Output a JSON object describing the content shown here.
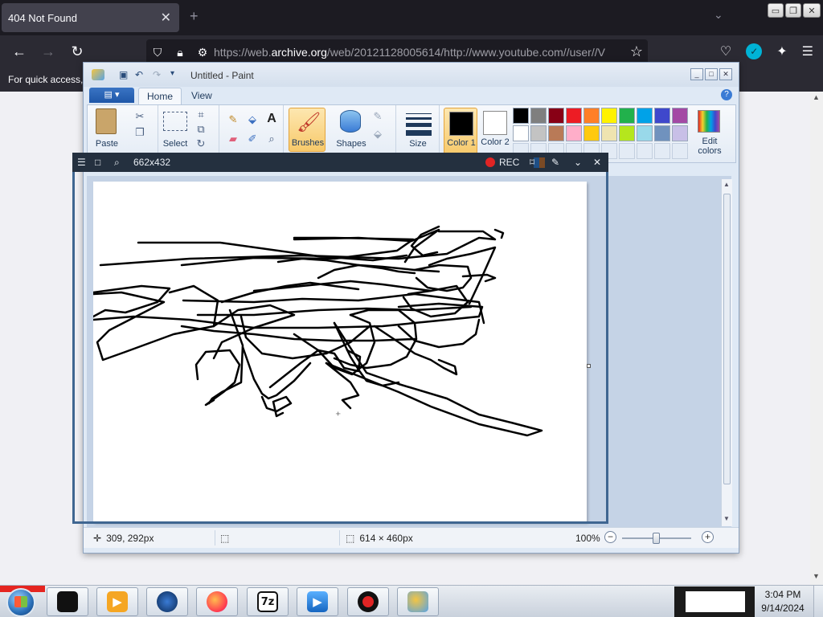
{
  "browser": {
    "tab_title": "404 Not Found",
    "tab_close": "✕",
    "new_tab": "+",
    "url_prefix": "https://web.",
    "url_domain": "archive.org",
    "url_rest": "/web/20121128005614/http://www.youtube.com//user//V",
    "bookmarks_text": "For quick access,",
    "window_controls": [
      "▭",
      "❐",
      "✕"
    ]
  },
  "paint": {
    "title": "Untitled - Paint",
    "tabs": [
      "Home",
      "View"
    ],
    "active_tab": "Home",
    "groups": {
      "paste": "Paste",
      "select": "Select",
      "brushes": "Brushes",
      "shapes": "Shapes",
      "size": "Size",
      "color1": "Color 1",
      "color2": "Color 2",
      "edit_colors": "Edit colors"
    },
    "color1": "#000000",
    "color2": "#ffffff",
    "palette_row1": [
      "#000000",
      "#7f7f7f",
      "#880015",
      "#ed1c24",
      "#ff7f27",
      "#fff200",
      "#22b14c",
      "#00a2e8",
      "#3f48cc",
      "#a349a4"
    ],
    "palette_row2": [
      "#ffffff",
      "#c3c3c3",
      "#b97a57",
      "#ffaec9",
      "#ffc90e",
      "#efe4b0",
      "#b5e61d",
      "#99d9ea",
      "#7092be",
      "#c8bfe7"
    ],
    "status": {
      "cursor_pos": "309, 292px",
      "image_size": "614 × 460px",
      "zoom": "100%"
    },
    "zoom_level": 1.0
  },
  "recorder": {
    "dimensions": "662x432",
    "rec_label": "REC"
  },
  "taskbar": {
    "clock_time": "3:04 PM",
    "clock_date": "9/14/2024",
    "items": [
      "terminal",
      "media-player",
      "globe",
      "firefox",
      "7zip",
      "player",
      "recorder",
      "paint"
    ]
  }
}
